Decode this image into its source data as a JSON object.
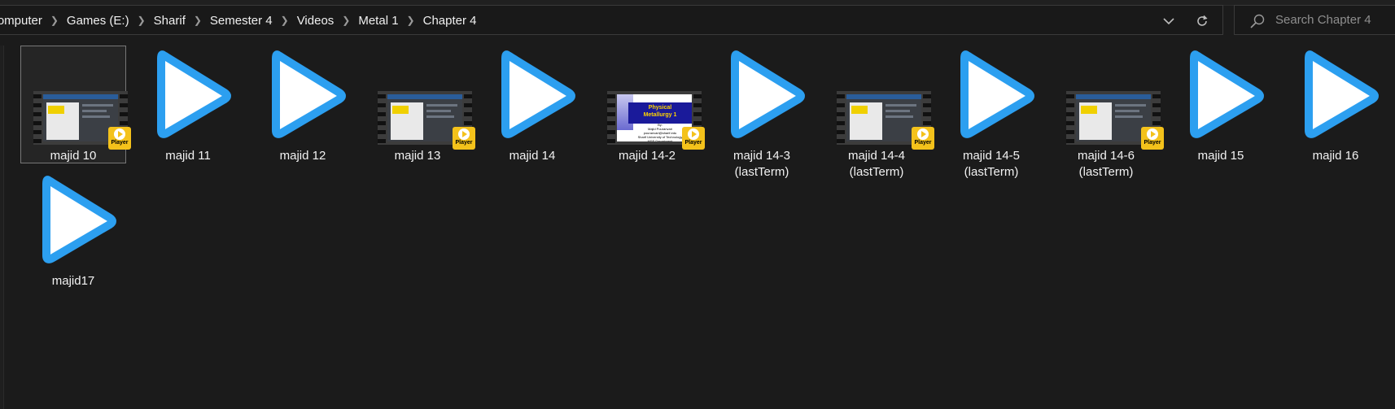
{
  "breadcrumb": [
    "Computer",
    "Games (E:)",
    "Sharif",
    "Semester 4",
    "Videos",
    "Metal 1",
    "Chapter 4"
  ],
  "search": {
    "placeholder": "Search Chapter 4"
  },
  "colors": {
    "play_blue": "#2c9ff0",
    "badge_yellow": "#f4c21b",
    "background": "#1b1b1b"
  },
  "files": [
    {
      "name": "majid 10",
      "thumb": "video-screenshot",
      "selected": true
    },
    {
      "name": "majid 11",
      "thumb": "play-icon"
    },
    {
      "name": "majid 12",
      "thumb": "play-icon"
    },
    {
      "name": "majid 13",
      "thumb": "video-screenshot"
    },
    {
      "name": "majid 14",
      "thumb": "play-icon"
    },
    {
      "name": "majid 14-2",
      "thumb": "video-screenshot",
      "title_slide": [
        "Physical",
        "Metallurgy 1",
        "By:",
        "Majid Pouranvari",
        "pouranvari@sharif.edu",
        "Sharif University of Technology",
        "MSE Department"
      ]
    },
    {
      "name": "majid 14-3\n(lastTerm)",
      "thumb": "play-icon"
    },
    {
      "name": "majid 14-4\n(lastTerm)",
      "thumb": "video-screenshot"
    },
    {
      "name": "majid 14-5\n(lastTerm)",
      "thumb": "play-icon"
    },
    {
      "name": "majid 14-6\n(lastTerm)",
      "thumb": "video-screenshot"
    },
    {
      "name": "majid 15",
      "thumb": "play-icon"
    },
    {
      "name": "majid 16",
      "thumb": "play-icon"
    },
    {
      "name": "majid17",
      "thumb": "play-icon"
    }
  ],
  "badge_label": "Player"
}
